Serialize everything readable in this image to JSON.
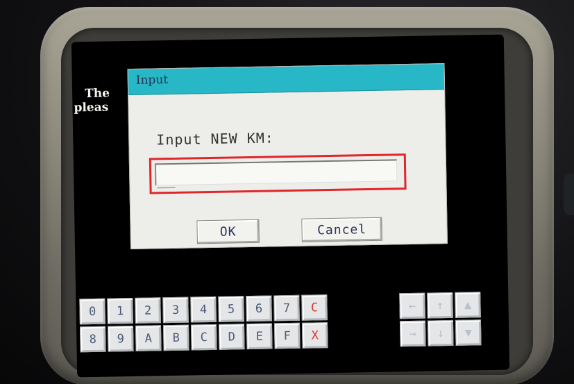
{
  "background_text": {
    "line1": "The",
    "line2": "pleas"
  },
  "dialog": {
    "title": "Input",
    "prompt": "Input NEW KM:",
    "input_value": "",
    "ok_label": "OK",
    "cancel_label": "Cancel",
    "highlight_color": "#e0262b",
    "titlebar_color": "#27b7c6"
  },
  "keypad": {
    "row1": [
      "0",
      "1",
      "2",
      "3",
      "4",
      "5",
      "6",
      "7",
      "C"
    ],
    "row2": [
      "8",
      "9",
      "A",
      "B",
      "C",
      "D",
      "E",
      "F",
      "X"
    ],
    "nav_row1": [
      "←",
      "↑",
      "▲"
    ],
    "nav_row2": [
      "→",
      "↓",
      "▼"
    ]
  }
}
